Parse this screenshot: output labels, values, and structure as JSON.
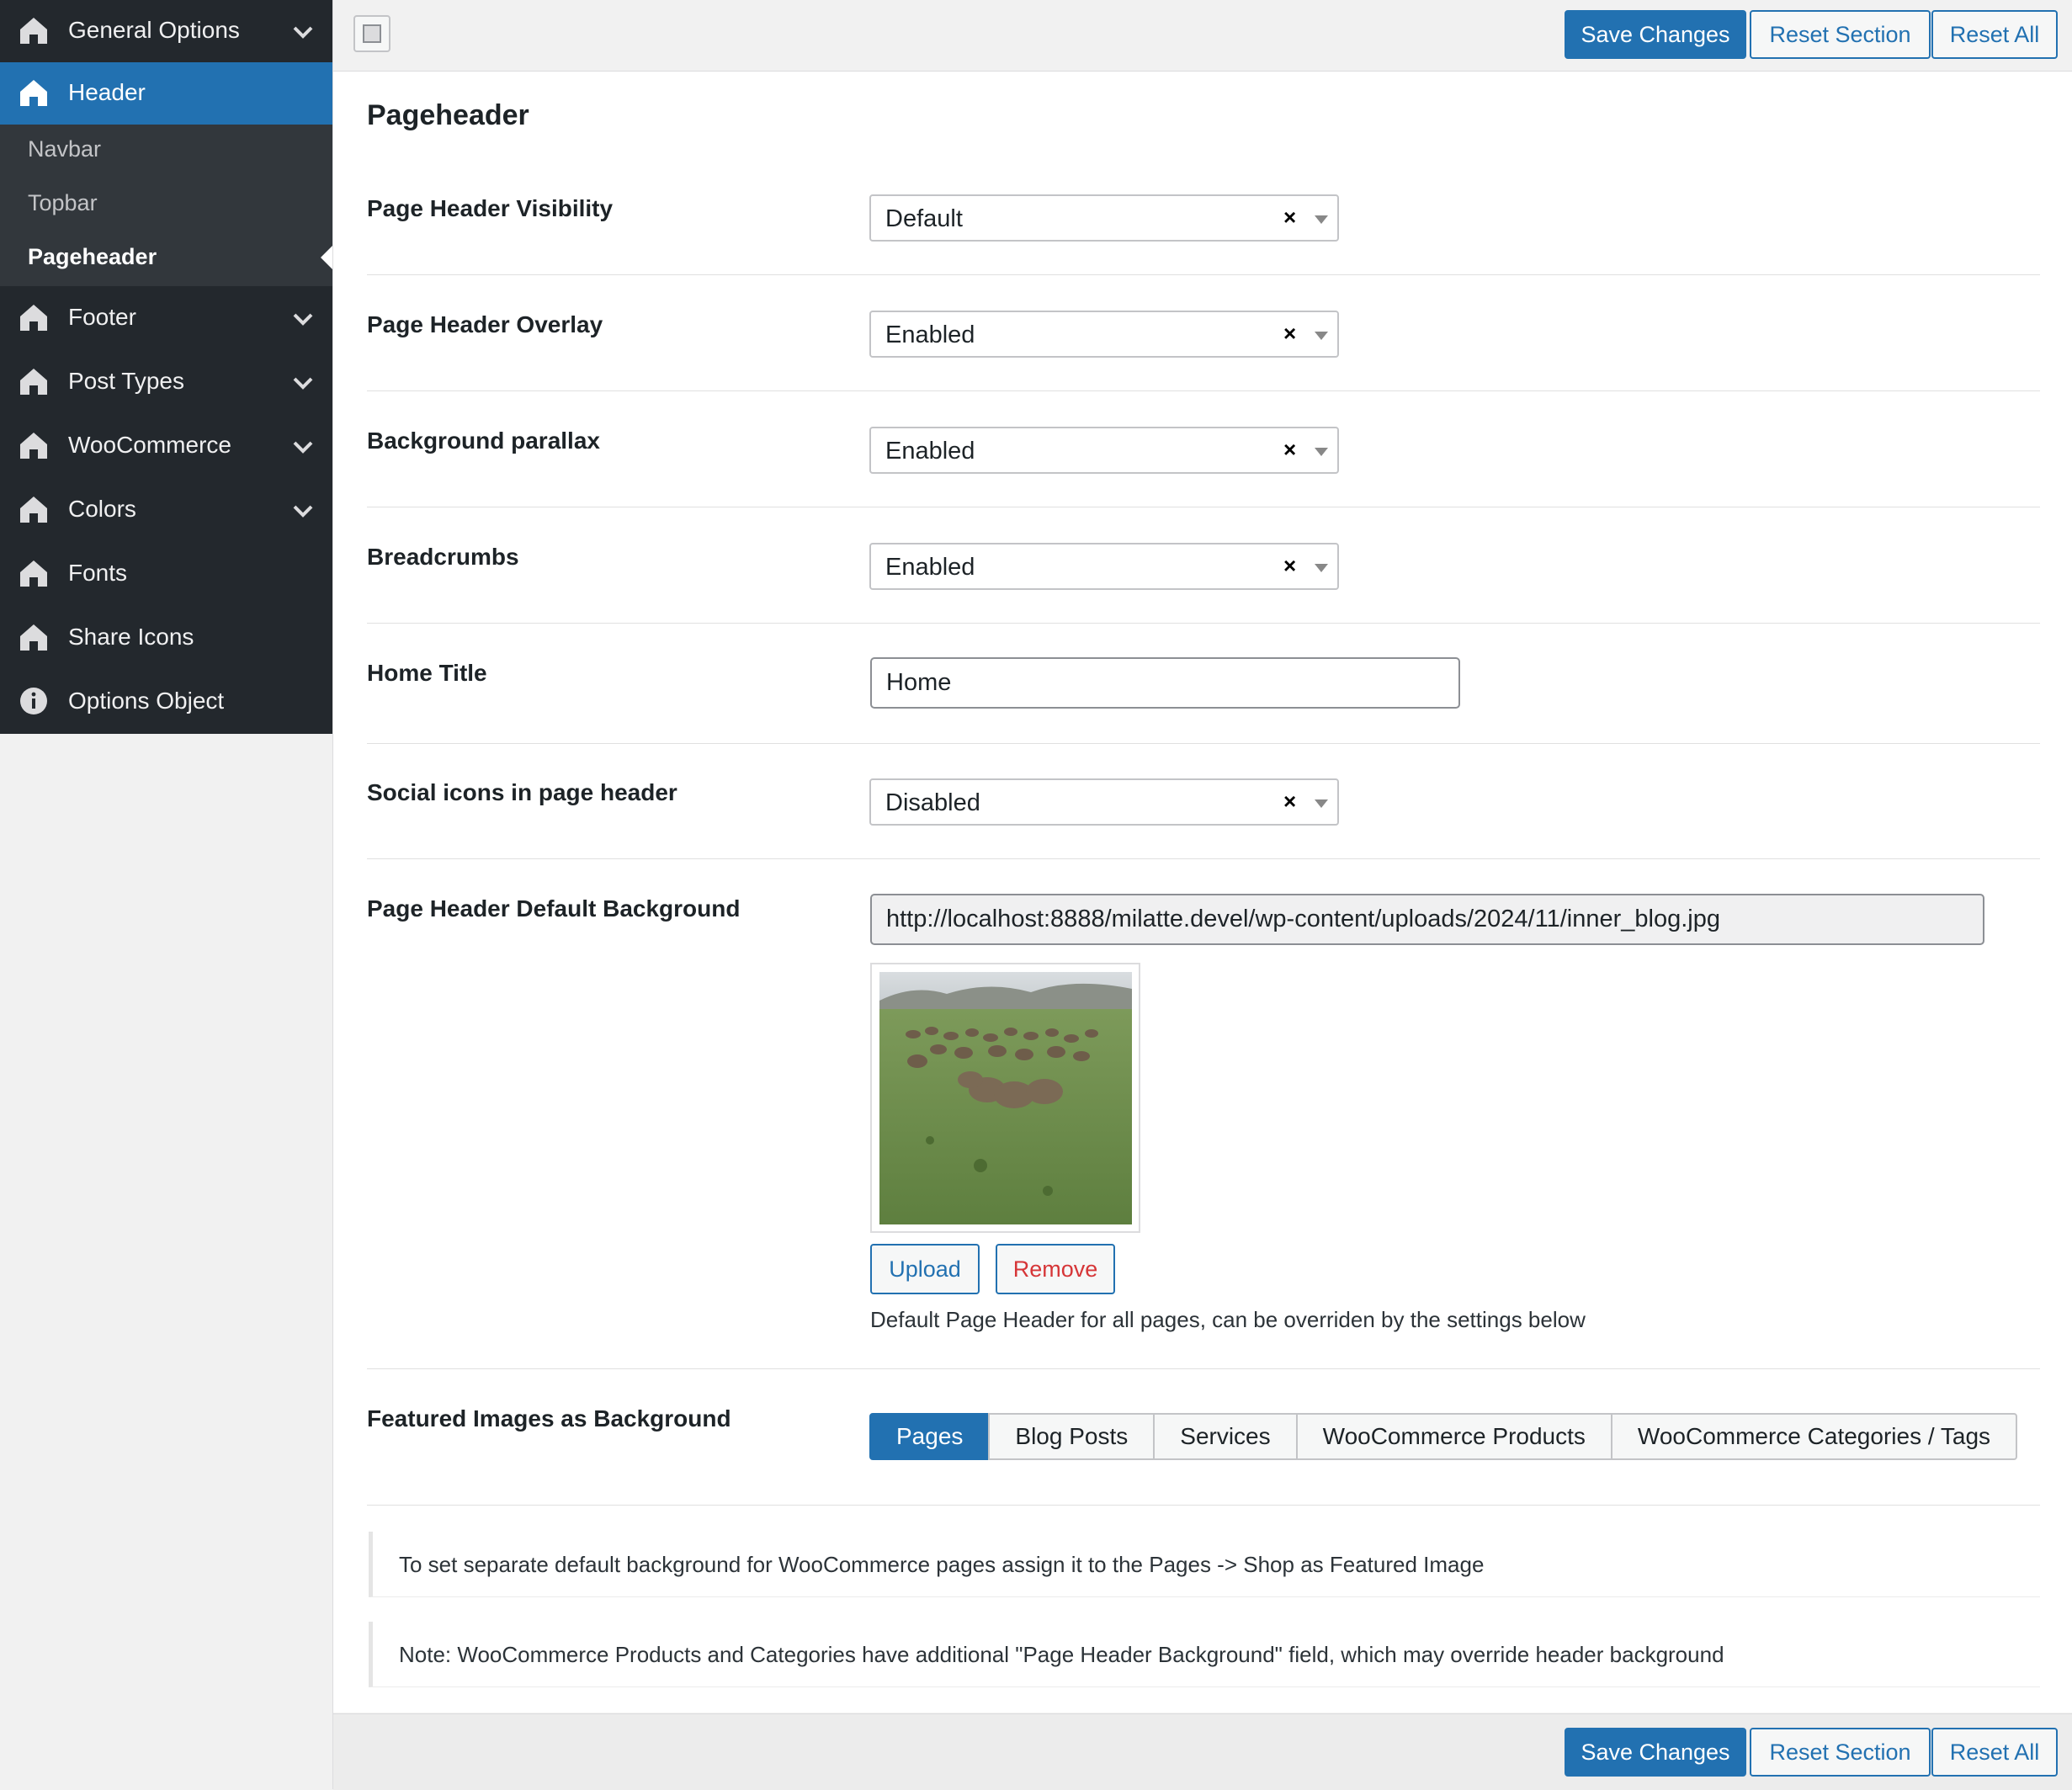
{
  "sidebar": {
    "items": [
      {
        "label": "General Options",
        "icon": "home-icon",
        "chevron": true,
        "active": false
      },
      {
        "label": "Header",
        "icon": "home-icon",
        "chevron": false,
        "active": true
      },
      {
        "label": "Footer",
        "icon": "home-icon",
        "chevron": true,
        "active": false
      },
      {
        "label": "Post Types",
        "icon": "home-icon",
        "chevron": true,
        "active": false
      },
      {
        "label": "WooCommerce",
        "icon": "home-icon",
        "chevron": true,
        "active": false
      },
      {
        "label": "Colors",
        "icon": "home-icon",
        "chevron": true,
        "active": false
      },
      {
        "label": "Fonts",
        "icon": "home-icon",
        "chevron": false,
        "active": false
      },
      {
        "label": "Share Icons",
        "icon": "home-icon",
        "chevron": false,
        "active": false
      },
      {
        "label": "Options Object",
        "icon": "info-icon",
        "chevron": false,
        "active": false
      }
    ],
    "submenu": [
      "Navbar",
      "Topbar",
      "Pageheader"
    ],
    "current_submenu": "Pageheader"
  },
  "toolbar": {
    "save_label": "Save Changes",
    "reset_section_label": "Reset Section",
    "reset_all_label": "Reset All"
  },
  "section": {
    "title": "Pageheader",
    "fields": {
      "visibility": {
        "label": "Page Header Visibility",
        "value": "Default"
      },
      "overlay": {
        "label": "Page Header Overlay",
        "value": "Enabled"
      },
      "parallax": {
        "label": "Background parallax",
        "value": "Enabled"
      },
      "breadcrumbs": {
        "label": "Breadcrumbs",
        "value": "Enabled"
      },
      "home_title": {
        "label": "Home Title",
        "value": "Home"
      },
      "social_icons": {
        "label": "Social icons in page header",
        "value": "Disabled"
      },
      "default_background": {
        "label": "Page Header Default Background",
        "url": "http://localhost:8888/milatte.devel/wp-content/uploads/2024/11/inner_blog.jpg",
        "upload_label": "Upload",
        "remove_label": "Remove",
        "description": "Default Page Header for all pages, can be overriden by the settings below"
      },
      "featured_images": {
        "label": "Featured Images as Background",
        "tabs": [
          "Pages",
          "Blog Posts",
          "Services",
          "WooCommerce Products",
          "WooCommerce Categories / Tags"
        ],
        "active_tab": "Pages"
      }
    },
    "notices": [
      "To set separate default background for WooCommerce pages assign it to the Pages -> Shop as Featured Image",
      "Note: WooCommerce Products and Categories have additional \"Page Header Background\" field, which may override header background"
    ]
  },
  "colors": {
    "accent": "#2271b1",
    "sidebar_bg": "#23282d",
    "submenu_bg": "#32373c",
    "remove": "#d63638"
  }
}
